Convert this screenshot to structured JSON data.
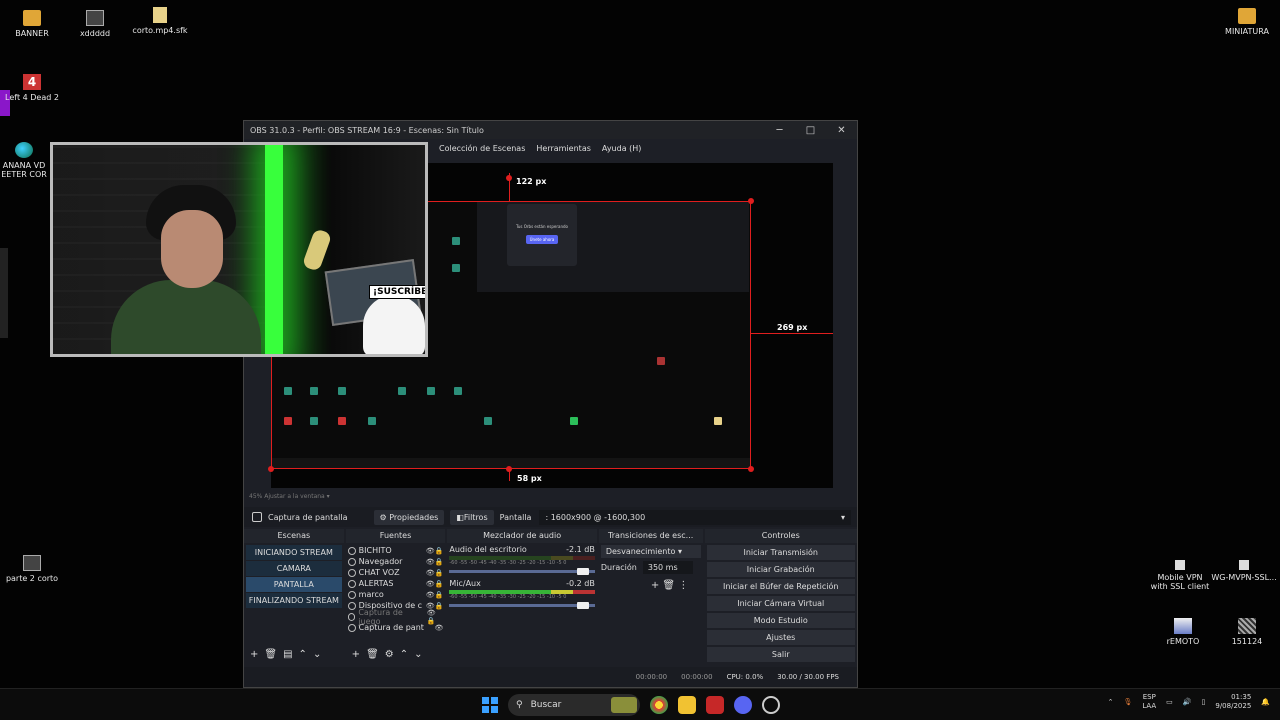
{
  "desktop": {
    "icons": [
      {
        "id": "banner",
        "label": "BANNER",
        "icon": "folder-icon"
      },
      {
        "id": "xddddd",
        "label": "xddddd",
        "icon": "video-file-icon"
      },
      {
        "id": "corto",
        "label": "corto.mp4.sfk",
        "icon": "file-icon"
      },
      {
        "id": "left4dead",
        "label": "Left 4 Dead 2",
        "icon": "game-icon",
        "glyph": "4"
      },
      {
        "id": "edge",
        "label": "ANANA VD EETER COR",
        "icon": "edge-icon"
      },
      {
        "id": "parte2",
        "label": "parte 2 corto",
        "icon": "video-file-icon"
      },
      {
        "id": "miniatura",
        "label": "MINIATURA",
        "icon": "folder-icon"
      },
      {
        "id": "mobilevpn",
        "label": "Mobile VPN with SSL client",
        "icon": "vpn-icon"
      },
      {
        "id": "wgvpn",
        "label": "WG-MVPN-SSL...",
        "icon": "vpn-icon"
      },
      {
        "id": "remoto",
        "label": "rEMOTO",
        "icon": "remote-desktop-icon"
      },
      {
        "id": "n151124",
        "label": "151124",
        "icon": "qr-file-icon"
      }
    ]
  },
  "webcam": {
    "sticker_text": "¡SUSCRÍBETE!"
  },
  "obs": {
    "title": "OBS 31.0.3 - Perfil: OBS STREAM 16:9 - Escenas: Sin Título",
    "window_controls": {
      "minimize": "─",
      "maximize": "□",
      "close": "✕"
    },
    "menu": [
      "Colección de Escenas",
      "Herramientas",
      "Ayuda (H)"
    ],
    "preview": {
      "px_top": "122 px",
      "px_right": "269 px",
      "px_bottom": "58 px",
      "chat_popup_title": "Tus Orbs están esperando",
      "chat_popup_button": "Únete ahora"
    },
    "zoom_label": "45% Ajustar a la ventana",
    "source_toolbar": {
      "source_name": "Captura de pantalla",
      "properties": "Propiedades",
      "filters": "Filtros",
      "display_label": "Pantalla",
      "display_value": ": 1600x900 @ -1600,300"
    },
    "scenes": {
      "header": "Escenas",
      "items": [
        {
          "name": "INICIANDO STREAM",
          "active": false
        },
        {
          "name": "CAMARA",
          "active": false
        },
        {
          "name": "PANTALLA",
          "active": true
        },
        {
          "name": "FINALIZANDO STREAM",
          "active": false
        }
      ]
    },
    "sources": {
      "header": "Fuentes",
      "items": [
        {
          "name": "BICHITO",
          "dim": false
        },
        {
          "name": "Navegador",
          "dim": false
        },
        {
          "name": "CHAT VOZ",
          "dim": false
        },
        {
          "name": "ALERTAS",
          "dim": false
        },
        {
          "name": "marco",
          "dim": false
        },
        {
          "name": "Dispositivo de c",
          "dim": false
        },
        {
          "name": "Captura de juego",
          "dim": true
        },
        {
          "name": "Captura de pant",
          "dim": false
        }
      ]
    },
    "mixer": {
      "header": "Mezclador de audio",
      "channels": [
        {
          "name": "Audio del escritorio",
          "db": "-2.1 dB",
          "active": false
        },
        {
          "name": "Mic/Aux",
          "db": "-0.2 dB",
          "active": true
        }
      ],
      "scale": "-60 -55 -50 -45 -40 -35 -30 -25 -20 -15 -10 -5 0"
    },
    "transitions": {
      "header": "Transiciones de esc...",
      "selected": "Desvanecimiento",
      "duration_label": "Duración",
      "duration_value": "350 ms"
    },
    "controls": {
      "header": "Controles",
      "buttons": [
        "Iniciar Transmisión",
        "Iniciar Grabación",
        "Iniciar el Búfer de Repetición",
        "Iniciar Cámara Virtual",
        "Modo Estudio",
        "Ajustes",
        "Salir"
      ]
    },
    "status": {
      "stream_time": "00:00:00",
      "rec_time": "00:00:00",
      "cpu": "CPU: 0.0%",
      "fps": "30.00 / 30.00 FPS"
    }
  },
  "taskbar": {
    "search_placeholder": "Buscar",
    "lang_top": "ESP",
    "lang_bottom": "LAA",
    "time": "01:35",
    "date": "9/08/2025"
  }
}
